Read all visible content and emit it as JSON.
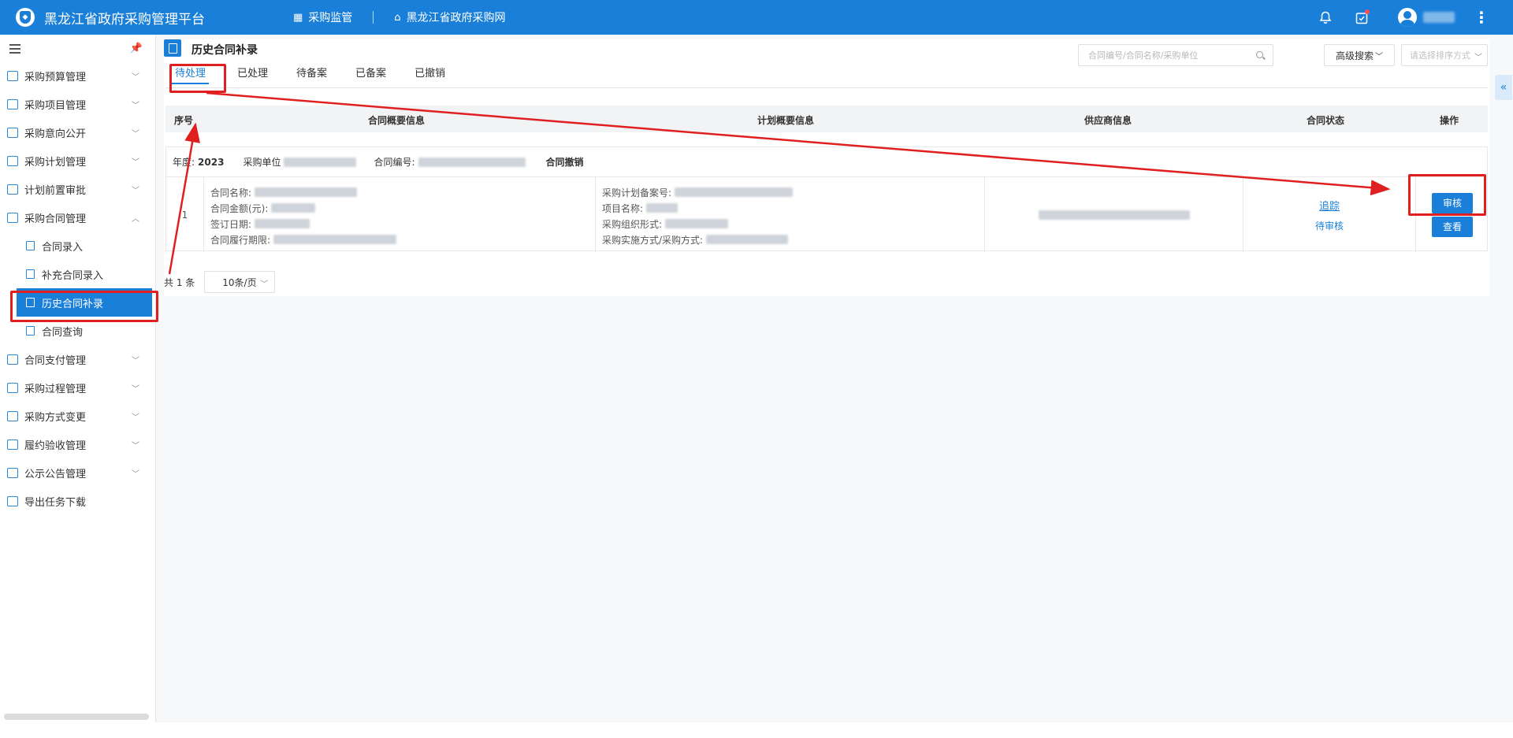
{
  "header": {
    "app_title": "黑龙江省政府采购管理平台",
    "nav_supervision": "采购监管",
    "nav_portal": "黑龙江省政府采购网"
  },
  "sidebar": {
    "items": [
      {
        "label": "采购预算管理"
      },
      {
        "label": "采购项目管理"
      },
      {
        "label": "采购意向公开"
      },
      {
        "label": "采购计划管理"
      },
      {
        "label": "计划前置审批"
      },
      {
        "label": "采购合同管理"
      }
    ],
    "sub_items": [
      {
        "label": "合同录入"
      },
      {
        "label": "补充合同录入"
      },
      {
        "label": "历史合同补录"
      },
      {
        "label": "合同查询"
      }
    ],
    "items_after": [
      {
        "label": "合同支付管理"
      },
      {
        "label": "采购过程管理"
      },
      {
        "label": "采购方式变更"
      },
      {
        "label": "履约验收管理"
      },
      {
        "label": "公示公告管理"
      },
      {
        "label": "导出任务下载"
      }
    ]
  },
  "page": {
    "title": "历史合同补录",
    "tabs": [
      "待处理",
      "已处理",
      "待备案",
      "已备案",
      "已撤销"
    ],
    "search_placeholder": "合同编号/合同名称/采购单位",
    "advanced_search": "高级搜索",
    "sort_placeholder": "请选择排序方式"
  },
  "table": {
    "headers": [
      "序号",
      "合同概要信息",
      "计划概要信息",
      "供应商信息",
      "合同状态",
      "操作"
    ],
    "group": {
      "year_label": "年度:",
      "year": "2023",
      "unit_label": "采购单位",
      "contract_no_label": "合同编号:",
      "revoke": "合同撤销"
    },
    "row": {
      "index": "1",
      "contract_fields": [
        "合同名称:",
        "合同金额(元):",
        "签订日期:",
        "合同履行期限:"
      ],
      "plan_fields": [
        "采购计划备案号:",
        "项目名称:",
        "采购组织形式:",
        "采购实施方式/采购方式:"
      ],
      "trace": "追踪",
      "status": "待审核",
      "btn_review": "审核",
      "btn_view": "查看"
    }
  },
  "pager": {
    "total": "共 1 条",
    "page_size": "10条/页"
  },
  "colors": {
    "brand": "#1a7fd9",
    "annotation": "#e02020"
  }
}
